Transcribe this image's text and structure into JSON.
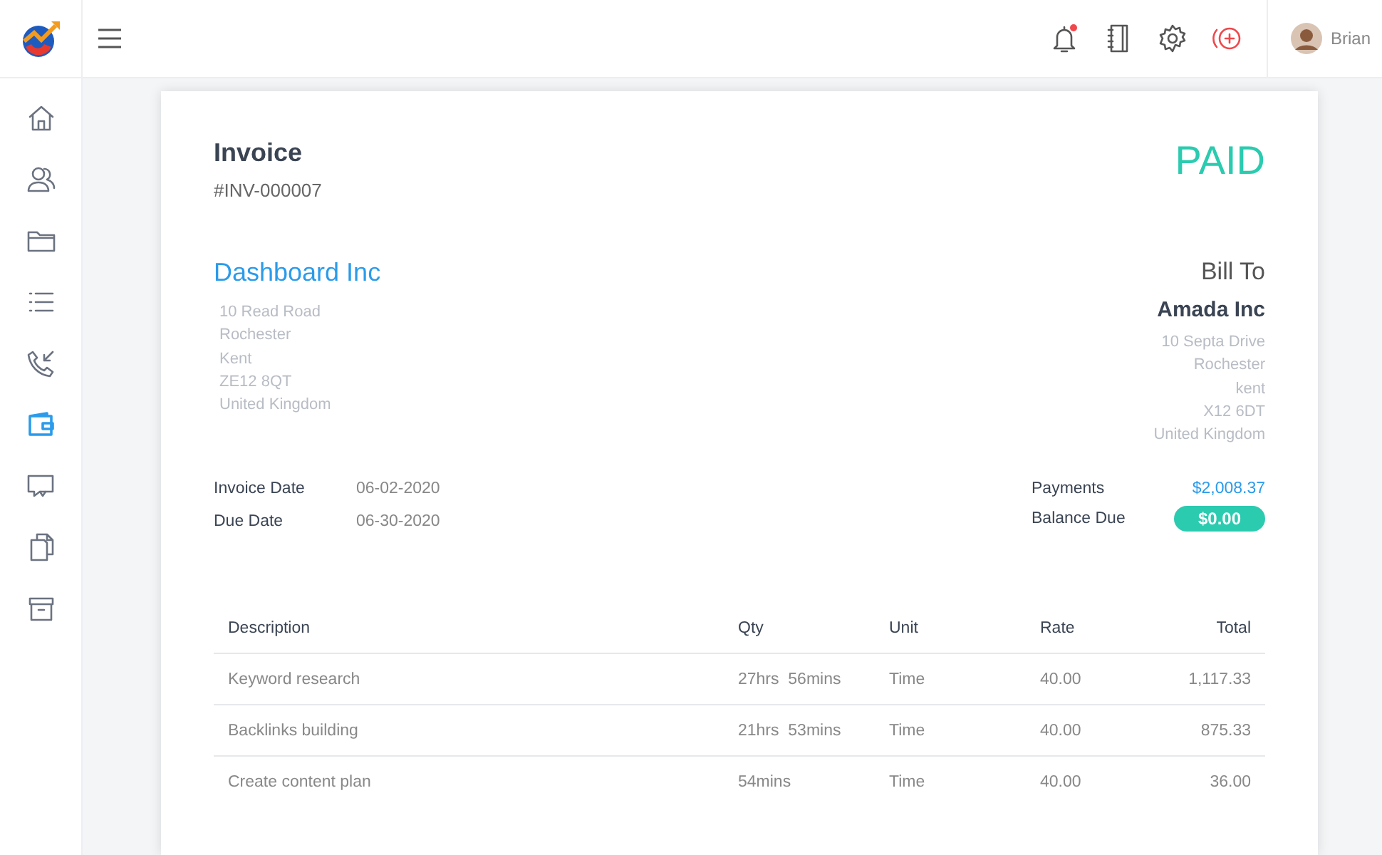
{
  "topbar": {
    "user": {
      "name": "Brian"
    },
    "bell": {
      "unread": true
    }
  },
  "sidebar": {
    "items": [
      {
        "kind": "home",
        "selected": false
      },
      {
        "kind": "users",
        "selected": false
      },
      {
        "kind": "folder",
        "selected": false
      },
      {
        "kind": "list",
        "selected": false
      },
      {
        "kind": "phone",
        "selected": false
      },
      {
        "kind": "wallet",
        "selected": true
      },
      {
        "kind": "chat",
        "selected": false
      },
      {
        "kind": "files",
        "selected": false
      },
      {
        "kind": "archive",
        "selected": false
      }
    ]
  },
  "invoice": {
    "title": "Invoice",
    "number": "#INV-000007",
    "status": "PAID",
    "from": {
      "name": "Dashboard Inc",
      "address": [
        "10 Read Road",
        "Rochester",
        "Kent",
        "ZE12 8QT",
        "United Kingdom"
      ]
    },
    "bill_to": {
      "heading": "Bill To",
      "name": "Amada Inc",
      "address": [
        "10 Septa Drive",
        "Rochester",
        "kent",
        "X12 6DT",
        "United Kingdom"
      ]
    },
    "dates": [
      {
        "label": "Invoice Date",
        "value": "06-02-2020"
      },
      {
        "label": "Due Date",
        "value": "06-30-2020"
      }
    ],
    "payments": {
      "label": "Payments",
      "value": "$2,008.37"
    },
    "balance": {
      "label": "Balance Due",
      "value": "$0.00"
    },
    "table": {
      "columns": [
        "Description",
        "Qty",
        "Unit",
        "Rate",
        "Total"
      ],
      "rows": [
        [
          "Keyword research",
          "27hrs  56mins",
          "Time",
          "40.00",
          "1,117.33"
        ],
        [
          "Backlinks building",
          "21hrs  53mins",
          "Time",
          "40.00",
          "875.33"
        ],
        [
          "Create content plan",
          "54mins",
          "Time",
          "40.00",
          "36.00"
        ]
      ]
    }
  }
}
